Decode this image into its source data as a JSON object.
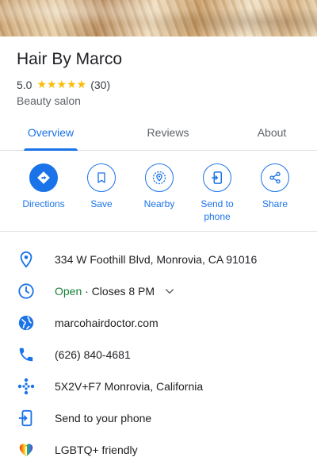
{
  "place": {
    "name": "Hair By Marco",
    "rating": "5.0",
    "stars": "★★★★★",
    "review_count": "(30)",
    "category": "Beauty salon"
  },
  "tabs": [
    {
      "label": "Overview",
      "active": true
    },
    {
      "label": "Reviews",
      "active": false
    },
    {
      "label": "About",
      "active": false
    }
  ],
  "actions": [
    {
      "label": "Directions",
      "icon": "directions-icon"
    },
    {
      "label": "Save",
      "icon": "bookmark-icon"
    },
    {
      "label": "Nearby",
      "icon": "nearby-icon"
    },
    {
      "label": "Send to\nphone",
      "label_line1": "Send to",
      "label_line2": "phone",
      "icon": "send-to-phone-icon"
    },
    {
      "label": "Share",
      "icon": "share-icon"
    }
  ],
  "info": {
    "address": "334 W Foothill Blvd, Monrovia, CA 91016",
    "hours_status": "Open",
    "hours_detail": " · Closes 8 PM",
    "website": "marcohairdoctor.com",
    "phone": "(626) 840-4681",
    "plus_code": "5X2V+F7 Monrovia, California",
    "send_to_phone": "Send to your phone",
    "lgbtq": "LGBTQ+ friendly"
  },
  "colors": {
    "accent": "#1a73e8",
    "open": "#188038",
    "star": "#fbbc04"
  }
}
